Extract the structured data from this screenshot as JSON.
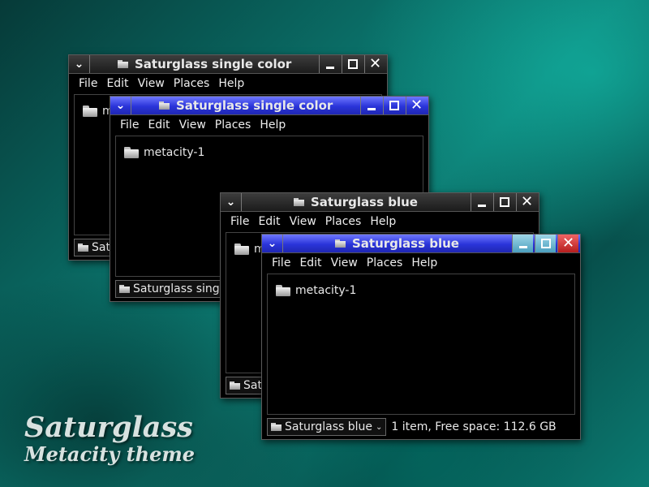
{
  "wallpaper": {
    "title": "Saturglass",
    "subtitle": "Metacity theme"
  },
  "windows": [
    {
      "title": "Saturglass single color",
      "menu": [
        "File",
        "Edit",
        "View",
        "Places",
        "Help"
      ],
      "file": "m",
      "status_location": "Sat",
      "status_text": ""
    },
    {
      "title": "Saturglass single color",
      "menu": [
        "File",
        "Edit",
        "View",
        "Places",
        "Help"
      ],
      "file": "metacity-1",
      "status_location": "Saturglass single",
      "status_text": ""
    },
    {
      "title": "Saturglass blue",
      "menu": [
        "File",
        "Edit",
        "View",
        "Places",
        "Help"
      ],
      "file": "m",
      "status_location": "Satu",
      "status_text": ""
    },
    {
      "title": "Saturglass blue",
      "menu": [
        "File",
        "Edit",
        "View",
        "Places",
        "Help"
      ],
      "file": "metacity-1",
      "status_location": "Saturglass blue",
      "status_text": "1 item, Free space: 112.6 GB"
    }
  ],
  "icons": {
    "window_menu": "chevron-down-icon",
    "minimize": "minimize-icon",
    "maximize": "maximize-icon",
    "close": "close-icon",
    "folder": "folder-icon"
  },
  "colors": {
    "active_title_blue": "#2a34d9",
    "close_red": "#b51d1d",
    "button_cyan": "#4b9fbe",
    "window_bg": "#000000"
  }
}
